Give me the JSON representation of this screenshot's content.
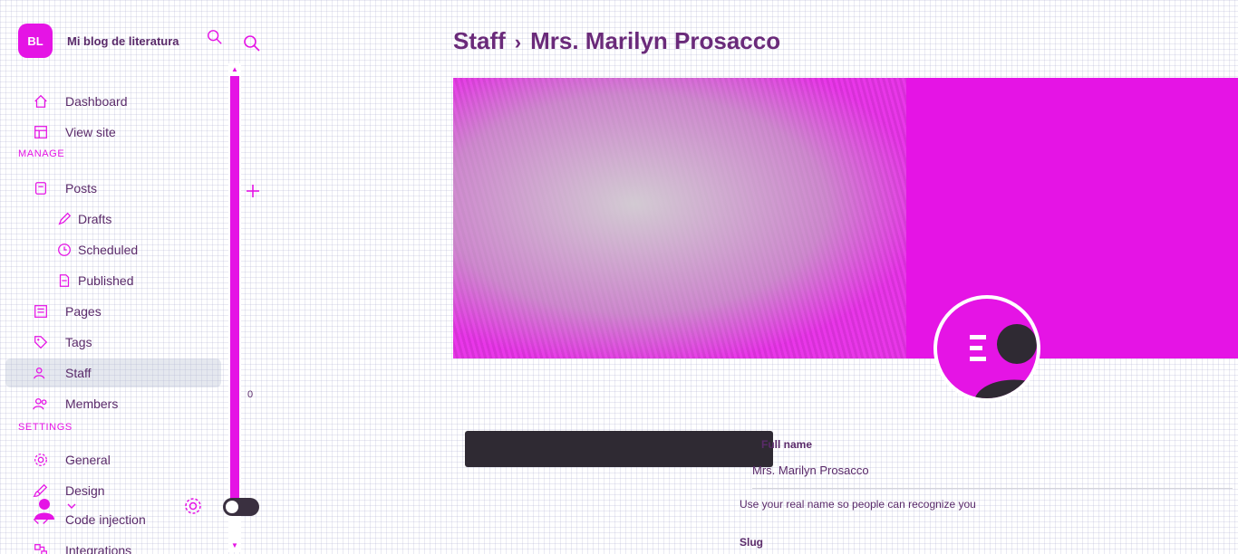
{
  "brand": {
    "name": "Mi blog de literatura",
    "logo_initials": "BL"
  },
  "sidebar": {
    "top_items": [
      {
        "label": "Dashboard",
        "icon": "home-icon"
      },
      {
        "label": "View site",
        "icon": "layout-icon"
      }
    ],
    "manage_label": "MANAGE",
    "manage_items": [
      {
        "label": "Posts",
        "icon": "post-icon"
      },
      {
        "label": "Drafts",
        "icon": "pencil-icon"
      },
      {
        "label": "Scheduled",
        "icon": "clock-icon"
      },
      {
        "label": "Published",
        "icon": "document-icon"
      },
      {
        "label": "Pages",
        "icon": "pages-icon"
      },
      {
        "label": "Tags",
        "icon": "tag-icon"
      },
      {
        "label": "Staff",
        "icon": "staff-icon"
      },
      {
        "label": "Members",
        "icon": "members-icon"
      }
    ],
    "settings_label": "SETTINGS",
    "settings_items": [
      {
        "label": "General",
        "icon": "gear-icon"
      },
      {
        "label": "Design",
        "icon": "brush-icon"
      },
      {
        "label": "Code injection",
        "icon": "code-icon"
      },
      {
        "label": "Integrations",
        "icon": "integrations-icon"
      }
    ]
  },
  "mid": {
    "count": "0"
  },
  "header": {
    "breadcrumb_root": "Staff",
    "breadcrumb_current": "Mrs. Marilyn Prosacco"
  },
  "profile": {
    "full_name_label": "Full name",
    "full_name_value": "Mrs. Marilyn Prosacco",
    "full_name_help": "Use your real name so people can recognize you",
    "slug_label": "Slug"
  },
  "colors": {
    "accent": "#e514e5",
    "text": "#5a2a6a",
    "dark": "#2f2a33"
  }
}
